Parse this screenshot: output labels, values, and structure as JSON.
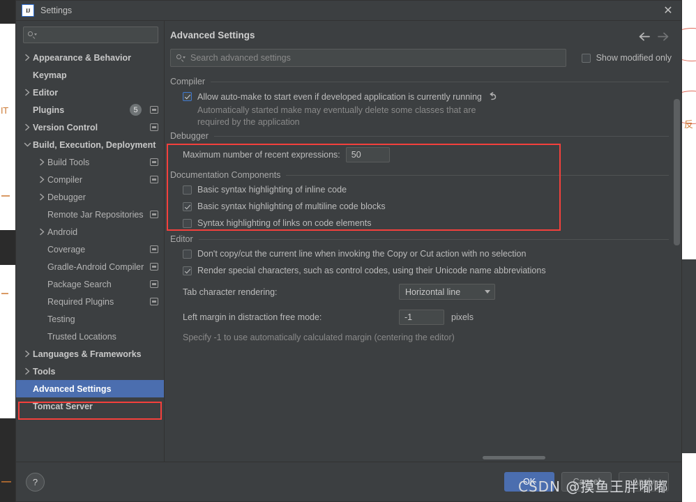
{
  "window": {
    "title": "Settings",
    "app_icon": "intellij-idea-icon",
    "close_icon": "close-icon"
  },
  "sidebar": {
    "search_placeholder": "",
    "search_icon": "search-icon",
    "items": [
      {
        "label": "Appearance & Behavior",
        "level": 0,
        "bold": true,
        "twisty": "right",
        "badge": null,
        "module_icon": false,
        "selected": false
      },
      {
        "label": "Keymap",
        "level": 0,
        "bold": true,
        "twisty": "none",
        "badge": null,
        "module_icon": false,
        "selected": false
      },
      {
        "label": "Editor",
        "level": 0,
        "bold": true,
        "twisty": "right",
        "badge": null,
        "module_icon": false,
        "selected": false
      },
      {
        "label": "Plugins",
        "level": 0,
        "bold": true,
        "twisty": "none",
        "badge": "5",
        "module_icon": true,
        "selected": false
      },
      {
        "label": "Version Control",
        "level": 0,
        "bold": true,
        "twisty": "right",
        "badge": null,
        "module_icon": true,
        "selected": false
      },
      {
        "label": "Build, Execution, Deployment",
        "level": 0,
        "bold": true,
        "twisty": "down",
        "badge": null,
        "module_icon": false,
        "selected": false
      },
      {
        "label": "Build Tools",
        "level": 1,
        "bold": false,
        "twisty": "right",
        "badge": null,
        "module_icon": true,
        "selected": false
      },
      {
        "label": "Compiler",
        "level": 1,
        "bold": false,
        "twisty": "right",
        "badge": null,
        "module_icon": true,
        "selected": false
      },
      {
        "label": "Debugger",
        "level": 1,
        "bold": false,
        "twisty": "right",
        "badge": null,
        "module_icon": false,
        "selected": false
      },
      {
        "label": "Remote Jar Repositories",
        "level": 1,
        "bold": false,
        "twisty": "none",
        "badge": null,
        "module_icon": true,
        "selected": false
      },
      {
        "label": "Android",
        "level": 1,
        "bold": false,
        "twisty": "right",
        "badge": null,
        "module_icon": false,
        "selected": false
      },
      {
        "label": "Coverage",
        "level": 1,
        "bold": false,
        "twisty": "none",
        "badge": null,
        "module_icon": true,
        "selected": false
      },
      {
        "label": "Gradle-Android Compiler",
        "level": 1,
        "bold": false,
        "twisty": "none",
        "badge": null,
        "module_icon": true,
        "selected": false
      },
      {
        "label": "Package Search",
        "level": 1,
        "bold": false,
        "twisty": "none",
        "badge": null,
        "module_icon": true,
        "selected": false
      },
      {
        "label": "Required Plugins",
        "level": 1,
        "bold": false,
        "twisty": "none",
        "badge": null,
        "module_icon": true,
        "selected": false
      },
      {
        "label": "Testing",
        "level": 1,
        "bold": false,
        "twisty": "none",
        "badge": null,
        "module_icon": false,
        "selected": false
      },
      {
        "label": "Trusted Locations",
        "level": 1,
        "bold": false,
        "twisty": "none",
        "badge": null,
        "module_icon": false,
        "selected": false
      },
      {
        "label": "Languages & Frameworks",
        "level": 0,
        "bold": true,
        "twisty": "right",
        "badge": null,
        "module_icon": false,
        "selected": false
      },
      {
        "label": "Tools",
        "level": 0,
        "bold": true,
        "twisty": "right",
        "badge": null,
        "module_icon": false,
        "selected": false
      },
      {
        "label": "Advanced Settings",
        "level": 0,
        "bold": true,
        "twisty": "none",
        "badge": null,
        "module_icon": false,
        "selected": true
      },
      {
        "label": "Tomcat Server",
        "level": 0,
        "bold": true,
        "twisty": "none",
        "badge": null,
        "module_icon": false,
        "selected": false
      }
    ]
  },
  "content": {
    "page_title": "Advanced Settings",
    "back_icon": "arrow-left-icon",
    "forward_icon": "arrow-right-icon",
    "search": {
      "placeholder": "Search advanced settings",
      "value": "",
      "icon": "search-icon"
    },
    "show_modified_only": {
      "label": "Show modified only",
      "checked": false
    },
    "sections": [
      {
        "title": "Compiler",
        "highlighted": true,
        "options": [
          {
            "type": "checkbox",
            "label": "Allow auto-make to start even if developed application is currently running",
            "checked": true,
            "accent": true,
            "revert_icon": "revert-icon",
            "description": "Automatically started make may eventually delete some classes that are required by the application"
          }
        ]
      },
      {
        "title": "Debugger",
        "highlighted": false,
        "options": [
          {
            "type": "text-field",
            "label": "Maximum number of recent expressions:",
            "value": "50"
          }
        ]
      },
      {
        "title": "Documentation Components",
        "highlighted": false,
        "options": [
          {
            "type": "checkbox",
            "label": "Basic syntax highlighting of inline code",
            "checked": false
          },
          {
            "type": "checkbox",
            "label": "Basic syntax highlighting of multiline code blocks",
            "checked": true
          },
          {
            "type": "checkbox",
            "label": "Syntax highlighting of links on code elements",
            "checked": false
          }
        ]
      },
      {
        "title": "Editor",
        "highlighted": false,
        "options": [
          {
            "type": "checkbox",
            "label": "Don't copy/cut the current line when invoking the Copy or Cut action with no selection",
            "checked": false
          },
          {
            "type": "checkbox",
            "label": "Render special characters, such as control codes, using their Unicode name abbreviations",
            "checked": true
          },
          {
            "type": "combo",
            "label": "Tab character rendering:",
            "value": "Horizontal line"
          },
          {
            "type": "text-field",
            "label": "Left margin in distraction free mode:",
            "value": "-1",
            "units": "pixels",
            "helper": "Specify -1 to use automatically calculated margin (centering the editor)"
          }
        ]
      }
    ]
  },
  "footer": {
    "help_label": "?",
    "ok_label": "OK",
    "cancel_label": "Cancel",
    "apply_label": "Apply"
  },
  "watermark": "CSDN @摸鱼王胖嘟嘟",
  "colors": {
    "dialog_bg": "#3c3f41",
    "selection_blue": "#4b6eaf",
    "highlight_red": "#f4403c",
    "accent_checkbox": "#3f79d0",
    "field_bg": "#45494a"
  }
}
